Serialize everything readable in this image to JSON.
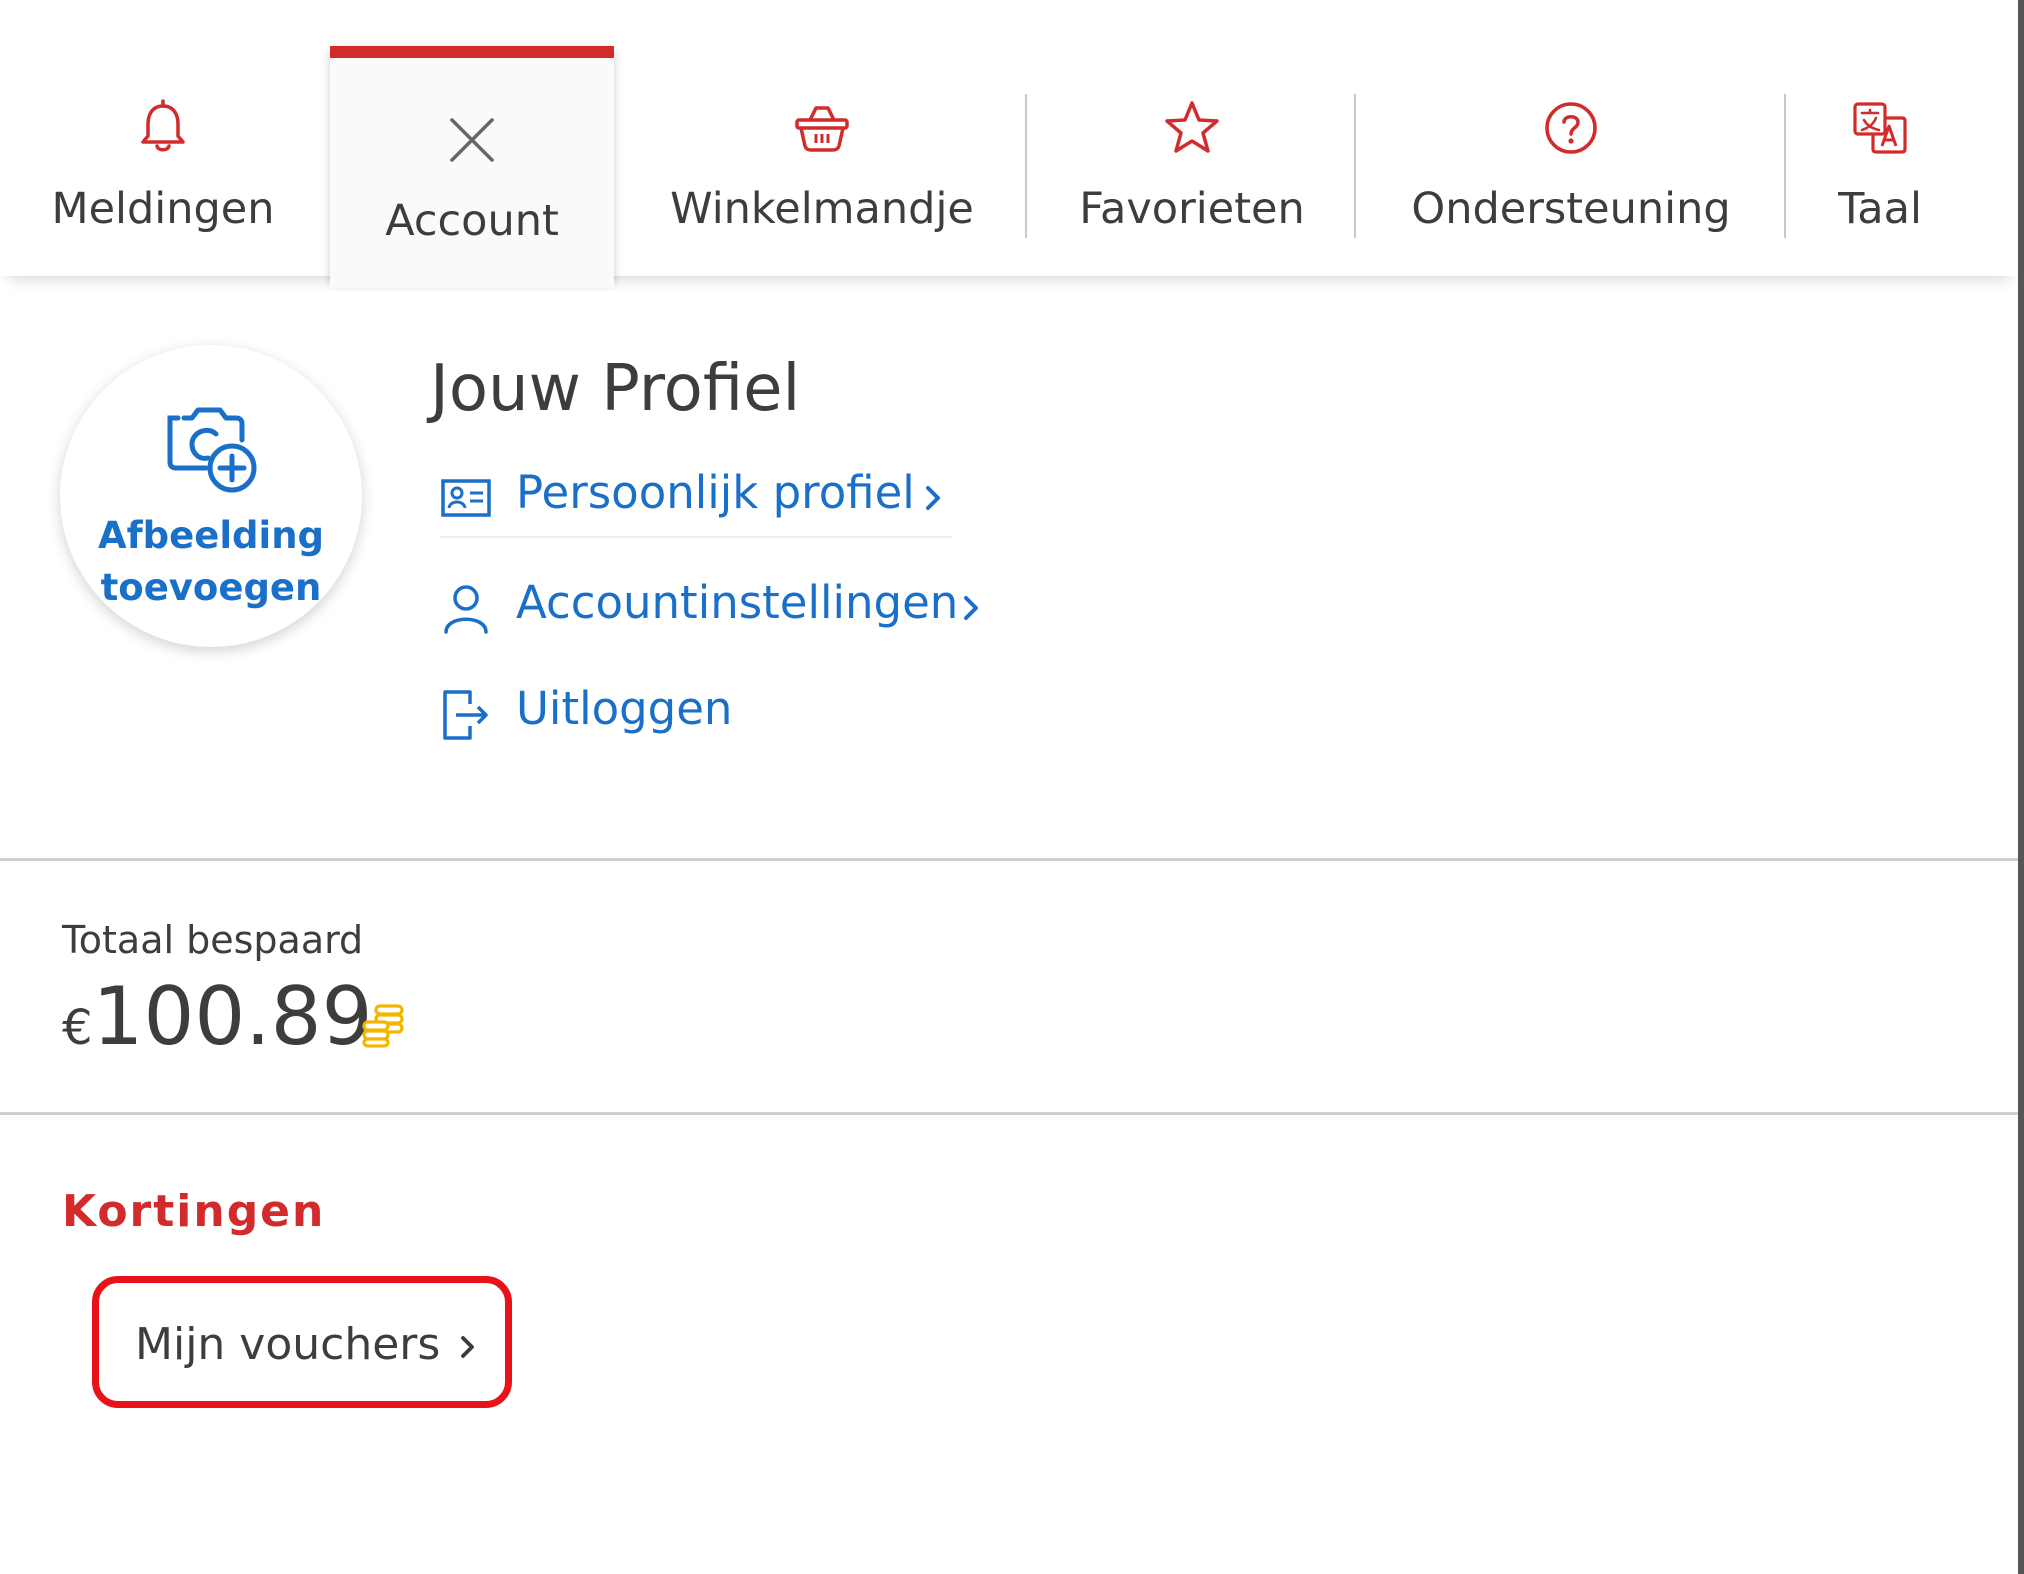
{
  "tabs": [
    {
      "label": "Meldingen",
      "icon": "bell-icon",
      "active": false
    },
    {
      "label": "Account",
      "icon": "close-icon",
      "active": true
    },
    {
      "label": "Winkelmandje",
      "icon": "basket-icon",
      "active": false
    },
    {
      "label": "Favorieten",
      "icon": "star-icon",
      "active": false
    },
    {
      "label": "Ondersteuning",
      "icon": "help-icon",
      "active": false
    },
    {
      "label": "Taal",
      "icon": "translate-icon",
      "active": false
    }
  ],
  "profile": {
    "avatar_label_line1": "Afbeelding",
    "avatar_label_line2": "toevoegen",
    "avatar_icon": "add-photo-icon",
    "title": "Jouw Profiel",
    "links": [
      {
        "label": "Persoonlijk profiel",
        "icon": "id-card-icon",
        "has_chevron": true
      },
      {
        "label": "Accountinstellingen",
        "icon": "person-icon",
        "has_chevron": true
      },
      {
        "label": "Uitloggen",
        "icon": "sign-out-icon",
        "has_chevron": false
      }
    ]
  },
  "savings": {
    "label": "Totaal bespaard",
    "currency": "€",
    "amount": "100.89",
    "icon": "coins-icon"
  },
  "discounts": {
    "heading": "Kortingen",
    "voucher_label": "Mijn vouchers"
  },
  "colors": {
    "accent_red": "#d22b2b",
    "link_blue": "#1a6fc9",
    "text_gray": "#3d3d3d",
    "coin_gold": "#f2b600",
    "highlight_box": "#e8131a"
  }
}
